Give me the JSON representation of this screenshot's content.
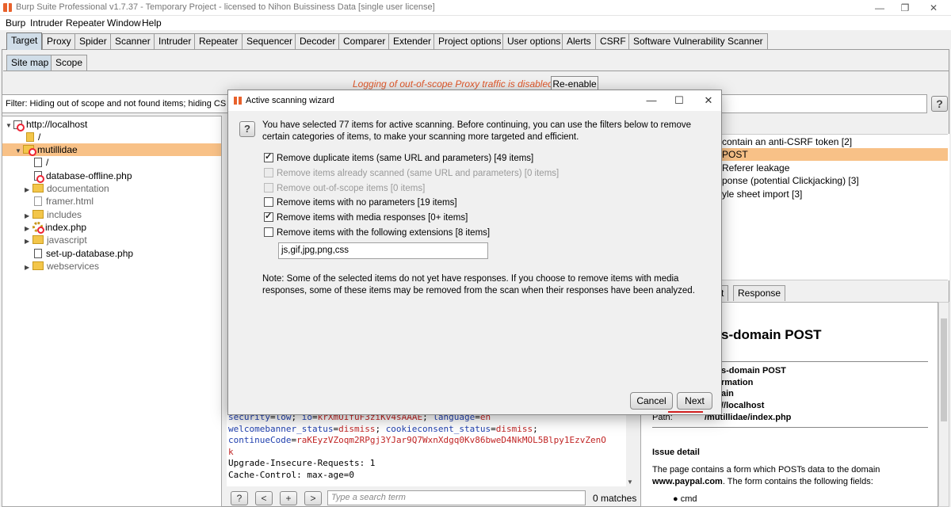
{
  "window": {
    "title": "Burp Suite Professional v1.7.37 - Temporary Project - licensed to Nihon Buissiness Data [single user license]"
  },
  "menu": [
    "Burp",
    "Intruder",
    "Repeater",
    "Window",
    "Help"
  ],
  "main_tabs": [
    "Target",
    "Proxy",
    "Spider",
    "Scanner",
    "Intruder",
    "Repeater",
    "Sequencer",
    "Decoder",
    "Comparer",
    "Extender",
    "Project options",
    "User options",
    "Alerts",
    "CSRF",
    "Software Vulnerability Scanner"
  ],
  "sub_tabs": [
    "Site map",
    "Scope"
  ],
  "oos": {
    "message": "Logging of out-of-scope Proxy traffic is disabled",
    "button": "Re-enable"
  },
  "filter": {
    "text": "Filter: Hiding out of scope and not found items;  hiding CS",
    "help": "?"
  },
  "tree": [
    {
      "label": "http://localhost",
      "type": "host"
    },
    {
      "label": "/",
      "type": "file"
    },
    {
      "label": "mutillidae",
      "type": "folder"
    },
    {
      "label": "/",
      "type": "file"
    },
    {
      "label": "database-offline.php",
      "type": "file"
    },
    {
      "label": "documentation",
      "type": "folder"
    },
    {
      "label": "framer.html",
      "type": "file"
    },
    {
      "label": "includes",
      "type": "folder"
    },
    {
      "label": "index.php",
      "type": "gear"
    },
    {
      "label": "javascript",
      "type": "folder"
    },
    {
      "label": "set-up-database.php",
      "type": "file"
    },
    {
      "label": "webservices",
      "type": "folder"
    }
  ],
  "issues": [
    "contain an anti-CSRF token [2]",
    "POST",
    "Referer leakage",
    "ponse (potential Clickjacking) [3]",
    "yle sheet import [3]"
  ],
  "right_tabs": [
    "st",
    "Response"
  ],
  "advisory": {
    "title": "s-domain POST",
    "row1": "s-domain POST",
    "row2": "rmation",
    "row3": "ain",
    "row4": "//localhost",
    "path_label": "Path:",
    "path_value": "/mutillidae/index.php",
    "detail_heading": "Issue detail",
    "detail_line1": "The page contains a form which POSTs data to the domain",
    "detail_domain": "www.paypal.com",
    "detail_line2": ". The form contains the following fields:",
    "field1": "cmd"
  },
  "request": {
    "line1_k1": "security",
    "line1_v1": "low",
    "line1_k2": "io",
    "line1_v2": "krXmUIfuF3ziKv4sAAAE",
    "line1_k3": "language",
    "line1_v3": "en",
    "line2_k1": "welcomebanner_status",
    "line2_v1": "dismiss",
    "line2_k2": "cookieconsent_status",
    "line2_v2": "dismiss",
    "line3_k1": "continueCode",
    "line3_v1": "raKEyzVZoqm2RPgj3YJar9Q7WxnXdgq0Kv86bweD4NkMOL5Blpy1EzvZenO",
    "line4": "k",
    "line5": "Upgrade-Insecure-Requests: 1",
    "line6": "Cache-Control: max-age=0"
  },
  "searchbar": {
    "buttons": [
      "?",
      "<",
      "+",
      ">"
    ],
    "placeholder": "Type a search term",
    "matches": "0 matches"
  },
  "dialog": {
    "title": "Active scanning wizard",
    "help": "?",
    "intro": "You have selected 77 items for active scanning. Before continuing, you can use the filters below to remove certain categories of items, to make your scanning more targeted and efficient.",
    "options": [
      {
        "label": "Remove duplicate items (same URL and parameters) [49 items]",
        "checked": true,
        "enabled": true
      },
      {
        "label": "Remove items already scanned (same URL and parameters) [0 items]",
        "checked": false,
        "enabled": false
      },
      {
        "label": "Remove out-of-scope items [0 items]",
        "checked": false,
        "enabled": false
      },
      {
        "label": "Remove items with no parameters [19 items]",
        "checked": false,
        "enabled": true
      },
      {
        "label": "Remove items with media responses [0+ items]",
        "checked": true,
        "enabled": true
      },
      {
        "label": "Remove items with the following extensions [8 items]",
        "checked": false,
        "enabled": true
      }
    ],
    "extensions_value": "js,gif,jpg,png,css",
    "note": "Note: Some of the selected items do not yet have responses. If you choose to remove items with media responses, some of these items may be removed from the scan when their responses have been analyzed.",
    "cancel": "Cancel",
    "next": "Next"
  },
  "colors": {
    "selection": "#f8c187",
    "accent": "#e8612c",
    "highlight_underline": "#d21f1f"
  }
}
